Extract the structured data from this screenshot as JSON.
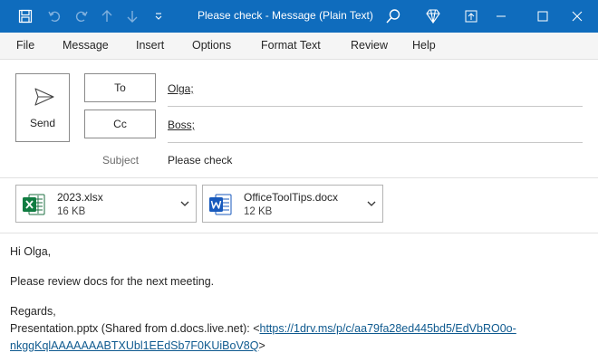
{
  "window": {
    "title": "Please check  -  Message (Plain Text)",
    "accent_color": "#0f6cbd",
    "toolbar_icons": [
      "save-icon",
      "undo-icon",
      "redo-icon",
      "up-arrow-icon",
      "down-arrow-icon",
      "customize-chevron-icon"
    ],
    "right_icons": [
      "search-icon",
      "diamond-icon",
      "popout-icon",
      "minimize-icon",
      "maximize-icon",
      "close-icon"
    ]
  },
  "menu": {
    "items": [
      "File",
      "Message",
      "Insert",
      "Options",
      "Format Text",
      "Review",
      "Help"
    ]
  },
  "compose": {
    "send_label": "Send",
    "to_label": "To",
    "to_value": "Olga;",
    "cc_label": "Cc",
    "cc_value": "Boss;",
    "subject_label": "Subject",
    "subject_value": "Please check"
  },
  "attachments": [
    {
      "name": "2023.xlsx",
      "size": "16 KB",
      "icon": "excel-icon"
    },
    {
      "name": "OfficeToolTips.docx",
      "size": "12 KB",
      "icon": "word-icon"
    }
  ],
  "body": {
    "greeting": "Hi Olga,",
    "line1": "Please review docs for the next meeting.",
    "regards": "Regards,",
    "share_prefix": "Presentation.pptx (Shared from d.docs.live.net): <",
    "link_part1": "https://1drv.ms/p/c/aa79fa28ed445bd5/EdVbRO0o-",
    "link_part2": "nkggKqlAAAAAAABTXUbl1EEdSb7F0KUiBoV8Q",
    "share_suffix": ">"
  }
}
